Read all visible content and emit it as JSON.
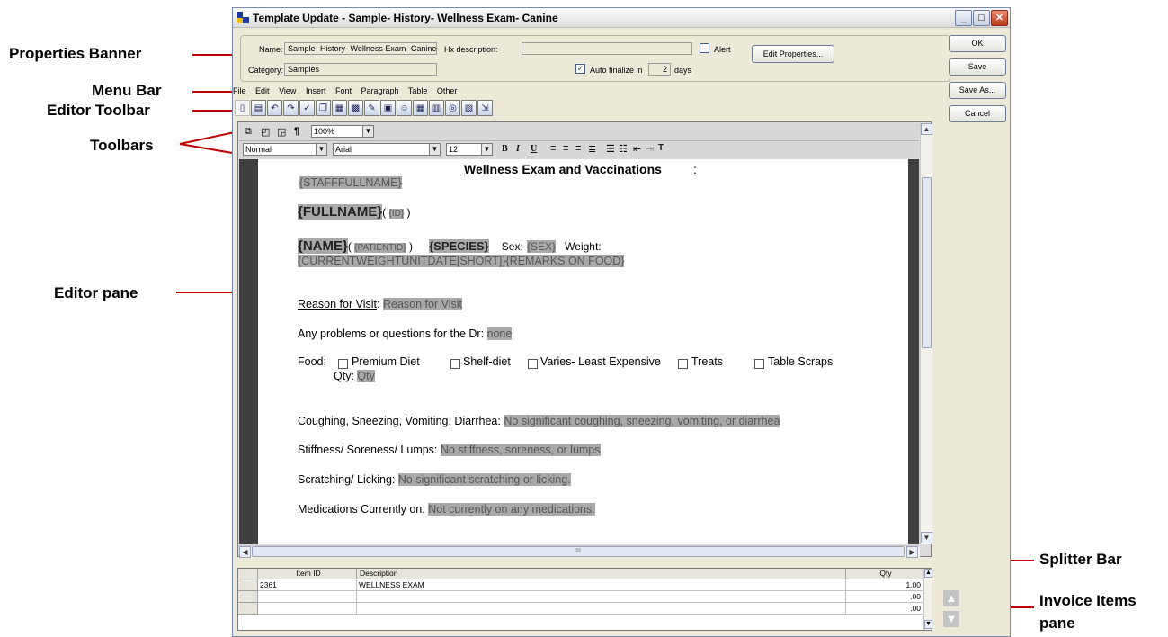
{
  "window": {
    "title": "Template Update - Sample- History- Wellness Exam- Canine"
  },
  "properties": {
    "name_label": "Name:",
    "name_value": "Sample- History- Wellness Exam- Canine",
    "hx_label": "Hx description:",
    "hx_value": "",
    "alert_label": "Alert",
    "edit_properties_label": "Edit Properties...",
    "category_label": "Category:",
    "category_value": "Samples",
    "auto_finalize_label": "Auto finalize in",
    "auto_finalize_days": "2",
    "days_label": "days"
  },
  "side_buttons": {
    "ok": "OK",
    "save": "Save",
    "save_as": "Save As...",
    "cancel": "Cancel"
  },
  "menu": [
    "File",
    "Edit",
    "View",
    "Insert",
    "Font",
    "Paragraph",
    "Table",
    "Other"
  ],
  "toolbar2": {
    "pilcrow": "¶",
    "zoom": "100%"
  },
  "format_bar": {
    "style": "Normal",
    "font": "Arial",
    "size": "12",
    "bold": "B",
    "italic": "I",
    "underline": "U"
  },
  "document": {
    "heading": "Wellness Exam and Vaccinations",
    "heading_suffix": ":",
    "staff": "{STAFFFULLNAME}",
    "fullname": "{FULLNAME}",
    "paren_open": "( ",
    "id_field": "{ID}",
    "paren_close": " )",
    "name_field": "{NAME}",
    "patientid_field": "{PATIENTID}",
    "species_field": "{SPECIES}",
    "sex_label": "Sex:",
    "sex_field": "{SEX}",
    "weight_label": "Weight:",
    "weight_field": "{CURRENTWEIGHTUNITDATE[SHORT]}",
    "remarks_field": "{REMARKS ON FOOD}",
    "reason_label": "Reason for Visit",
    "reason_value": "Reason for Visit",
    "problems_label": "Any problems or questions for the Dr:",
    "problems_value": "none",
    "food_label": "Food:",
    "food_options": [
      "Premium Diet",
      "Shelf-diet",
      "Varies- Least Expensive",
      "Treats",
      "Table Scraps"
    ],
    "qty_label": "Qty:",
    "qty_value": "Qty",
    "coughing_label": "Coughing, Sneezing, Vomiting, Diarrhea:",
    "coughing_value": "No significant coughing, sneezing, vomiting, or diarrhea",
    "stiffness_label": "Stiffness/ Soreness/ Lumps:",
    "stiffness_value": "No stiffness, soreness, or lumps",
    "scratching_label": "Scratching/ Licking:",
    "scratching_value": "No significant scratching or licking.",
    "meds_label": "Medications Currently on:",
    "meds_value": "Not currently on any medications."
  },
  "hscroll_label": "III",
  "invoice": {
    "columns": [
      "Item ID",
      "Description",
      "Qty"
    ],
    "rows": [
      {
        "item_id": "2361",
        "description": "WELLNESS EXAM",
        "qty": "1.00"
      },
      {
        "item_id": "",
        "description": "",
        "qty": ".00"
      },
      {
        "item_id": "",
        "description": "",
        "qty": ".00"
      }
    ]
  },
  "annotations": {
    "properties_banner": "Properties Banner",
    "menu_bar": "Menu Bar",
    "editor_toolbar": "Editor Toolbar",
    "toolbars": "Toolbars",
    "editor_pane": "Editor pane",
    "splitter_bar": "Splitter Bar",
    "invoice_items_pane": "Invoice Items pane"
  }
}
